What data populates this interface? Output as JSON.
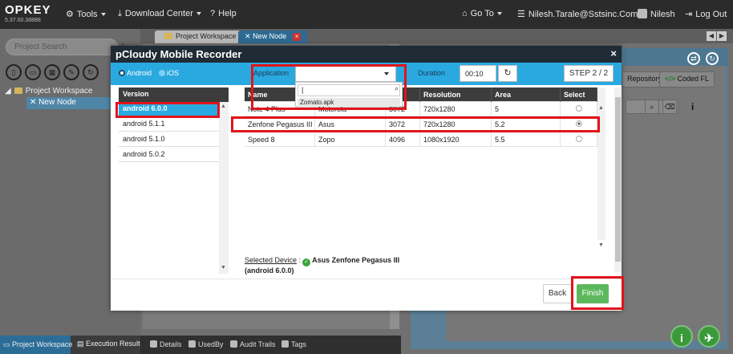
{
  "app": {
    "logo": "OPKEY",
    "version": "5.37.00.38888"
  },
  "nav": {
    "tools": "Tools",
    "download_center": "Download Center",
    "help": "Help",
    "go_to": "Go To",
    "email": "Nilesh.Tarale@Sstsinc.Com",
    "user": "Nilesh",
    "logout": "Log Out"
  },
  "left": {
    "search_placeholder": "Project Search",
    "tree_root": "Project Workspace",
    "tree_child": "New Node"
  },
  "tabs": [
    {
      "label": "Project Workspace"
    },
    {
      "label": "New Node"
    }
  ],
  "bg_right": {
    "repository_btn": "Repository",
    "coded_fl_btn": "Coded FL"
  },
  "bottom_left_tabs": {
    "project_workspace": "Project Workspace",
    "execution_result": "Execution Result"
  },
  "bottom_center_tabs": {
    "details": "Details",
    "used_by": "UsedBy",
    "audit_trails": "Audit Trails",
    "tags": "Tags"
  },
  "modal": {
    "title": "pCloudy Mobile Recorder",
    "platform_android": "Android",
    "platform_ios": "iOS",
    "application_label": "Application",
    "application_value": "",
    "duration_label": "Duration",
    "duration_value": "00:10",
    "step": "STEP 2 / 2",
    "dropdown_search_value": "|",
    "dropdown_option": "Zomato.apk",
    "version_header": "Version",
    "versions": [
      {
        "label": "android 6.0.0",
        "selected": true
      },
      {
        "label": "android 5.1.1",
        "selected": false
      },
      {
        "label": "android 5.1.0",
        "selected": false
      },
      {
        "label": "android 5.0.2",
        "selected": false
      }
    ],
    "table_headers": {
      "name": "Name",
      "brand": "",
      "ram": "",
      "resolution": "Resolution",
      "area": "Area",
      "select": "Select"
    },
    "devices": [
      {
        "name": "Note 4 Plus",
        "brand": "Motorola",
        "ram": "3072",
        "resolution": "720x1280",
        "area": "5",
        "selected": false
      },
      {
        "name": "Zenfone Pegasus III",
        "brand": "Asus",
        "ram": "3072",
        "resolution": "720x1280",
        "area": "5.2",
        "selected": true
      },
      {
        "name": "Speed 8",
        "brand": "Zopo",
        "ram": "4096",
        "resolution": "1080x1920",
        "area": "5.5",
        "selected": false
      }
    ],
    "selected_device_label": "Selected Device",
    "selected_device_value": "Asus Zenfone Pegasus III (android 6.0.0)",
    "back": "Back",
    "finish": "Finish"
  },
  "colors": {
    "modal_header": "#1f2b35",
    "accent_blue": "#2aa9e0",
    "finish_green": "#5cb85c",
    "highlight_red": "#e0141c"
  }
}
